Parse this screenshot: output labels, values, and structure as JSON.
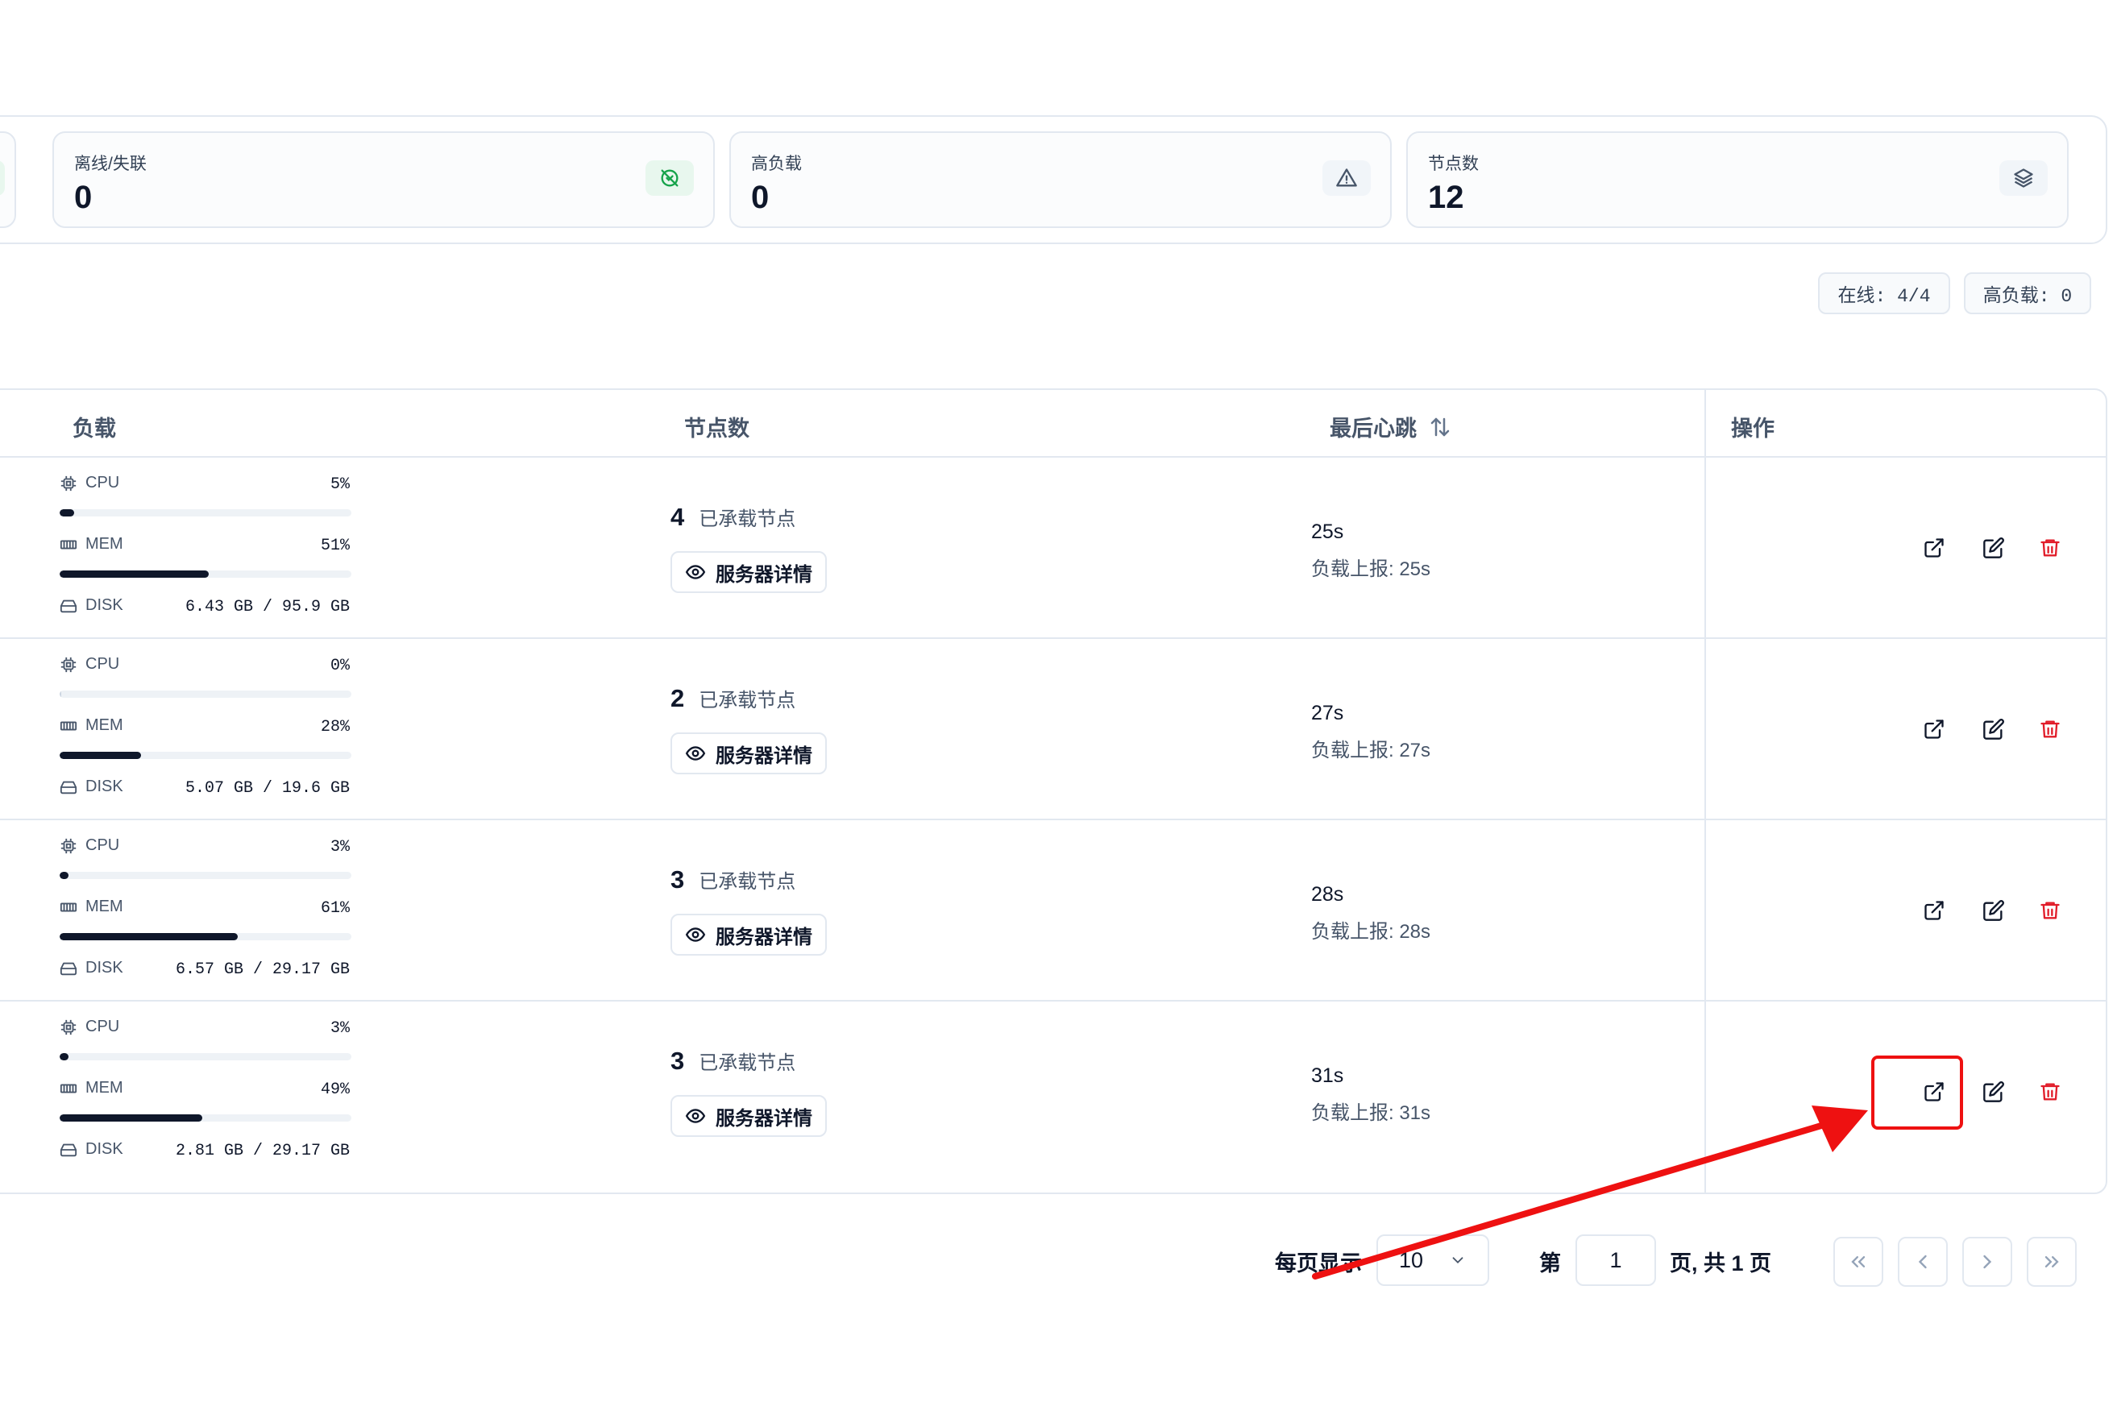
{
  "stats": [
    {
      "label": "离线/失联",
      "value": "0",
      "icon": "unlink-icon"
    },
    {
      "label": "高负载",
      "value": "0",
      "icon": "alert-triangle-icon"
    },
    {
      "label": "节点数",
      "value": "12",
      "icon": "layers-icon"
    }
  ],
  "summary_pills": {
    "online": "在线: 4/4",
    "high_load": "高负载: 0"
  },
  "table": {
    "headers": {
      "load": "负载",
      "nodes": "节点数",
      "heartbeat": "最后心跳",
      "actions": "操作"
    },
    "resource_labels": {
      "cpu": "CPU",
      "mem": "MEM",
      "disk": "DISK"
    },
    "node_suffix": "已承载节点",
    "detail_label": "服务器详情",
    "rows": [
      {
        "cpu": "5%",
        "cpu_pct": 0.05,
        "mem": "51%",
        "mem_pct": 0.51,
        "disk": "6.43 GB / 95.9 GB",
        "nodes": "4",
        "heartbeat": "25s",
        "report": "负载上报: 25s"
      },
      {
        "cpu": "0%",
        "cpu_pct": 0.0,
        "mem": "28%",
        "mem_pct": 0.28,
        "disk": "5.07 GB / 19.6 GB",
        "nodes": "2",
        "heartbeat": "27s",
        "report": "负载上报: 27s"
      },
      {
        "cpu": "3%",
        "cpu_pct": 0.03,
        "mem": "61%",
        "mem_pct": 0.61,
        "disk": "6.57 GB / 29.17 GB",
        "nodes": "3",
        "heartbeat": "28s",
        "report": "负载上报: 28s"
      },
      {
        "cpu": "3%",
        "cpu_pct": 0.03,
        "mem": "49%",
        "mem_pct": 0.49,
        "disk": "2.81 GB / 29.17 GB",
        "nodes": "3",
        "heartbeat": "31s",
        "report": "负载上报: 31s"
      }
    ]
  },
  "pagination": {
    "per_page_label": "每页显示",
    "per_page_value": "10",
    "page_prefix": "第",
    "current_page": "1",
    "page_suffix": "页, 共 1 页"
  },
  "colors": {
    "accent_red": "#e11d2a",
    "annotation_red": "#ee1111",
    "green": "#16a34a",
    "primary": "#0f172a"
  }
}
